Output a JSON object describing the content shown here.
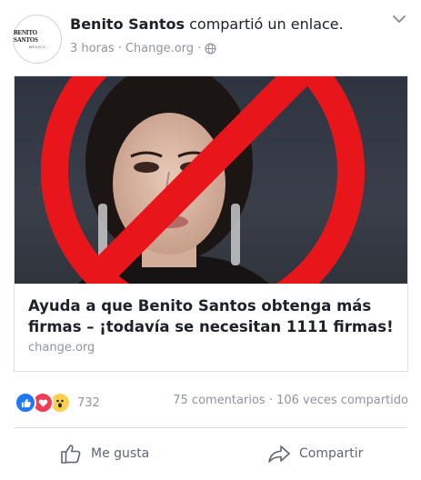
{
  "post": {
    "author": "Benito Santos",
    "action_text": " compartió un enlace.",
    "time": "3 horas",
    "separator": "·",
    "source": "Change.org",
    "avatar_logo": "BENITO SANTOS",
    "avatar_sub": "MÉXICO",
    "privacy_icon": "globe-icon",
    "menu_icon": "chevron-down-icon"
  },
  "link_card": {
    "title": "Ayuda a que Benito Santos obtenga más firmas – ¡todavía se necesitan 1111 firmas!",
    "domain": "change.org",
    "image_overlay": "prohibition-sign",
    "overlay_color": "#e8161b"
  },
  "stats": {
    "reaction_icons": [
      "like-icon",
      "love-icon",
      "wow-icon"
    ],
    "reaction_count": "732",
    "comments_shares": "75 comentarios · 106 veces compartido"
  },
  "actions": {
    "like_label": "Me gusta",
    "share_label": "Compartir"
  },
  "colors": {
    "like_blue": "#2078f4",
    "love_red": "#f33e58",
    "wow_yellow": "#fcd04e",
    "meta_gray": "#90949c"
  }
}
